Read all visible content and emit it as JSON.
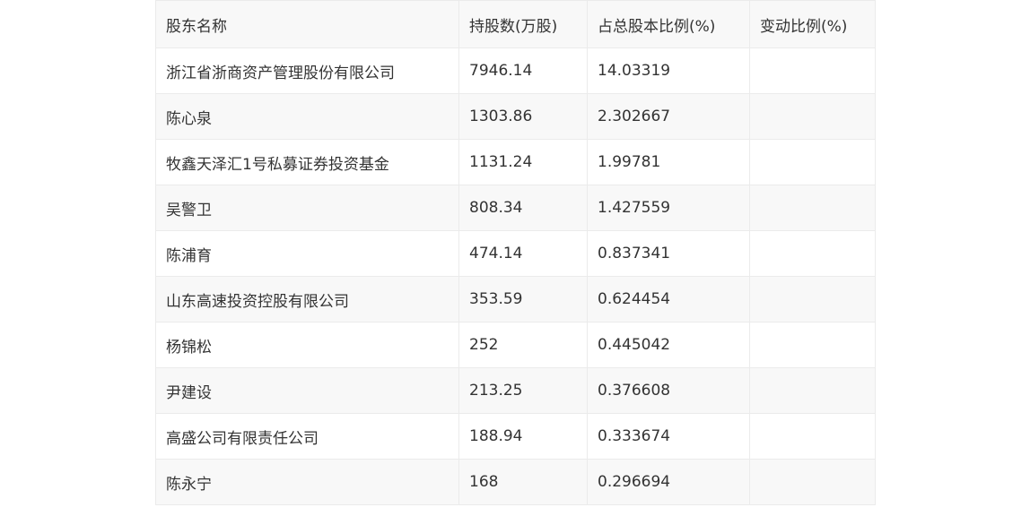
{
  "table": {
    "headers": [
      "股东名称",
      "持股数(万股)",
      "占总股本比例(%)",
      "变动比例(%)"
    ],
    "rows": [
      [
        "浙江省浙商资产管理股份有限公司",
        "7946.14",
        "14.03319",
        ""
      ],
      [
        "陈心泉",
        "1303.86",
        "2.302667",
        ""
      ],
      [
        "牧鑫天泽汇1号私募证券投资基金",
        "1131.24",
        "1.99781",
        ""
      ],
      [
        "吴警卫",
        "808.34",
        "1.427559",
        ""
      ],
      [
        "陈浦育",
        "474.14",
        "0.837341",
        ""
      ],
      [
        "山东高速投资控股有限公司",
        "353.59",
        "0.624454",
        ""
      ],
      [
        "杨锦松",
        "252",
        "0.445042",
        ""
      ],
      [
        "尹建设",
        "213.25",
        "0.376608",
        ""
      ],
      [
        "高盛公司有限责任公司",
        "188.94",
        "0.333674",
        ""
      ],
      [
        "陈永宁",
        "168",
        "0.296694",
        ""
      ]
    ]
  }
}
